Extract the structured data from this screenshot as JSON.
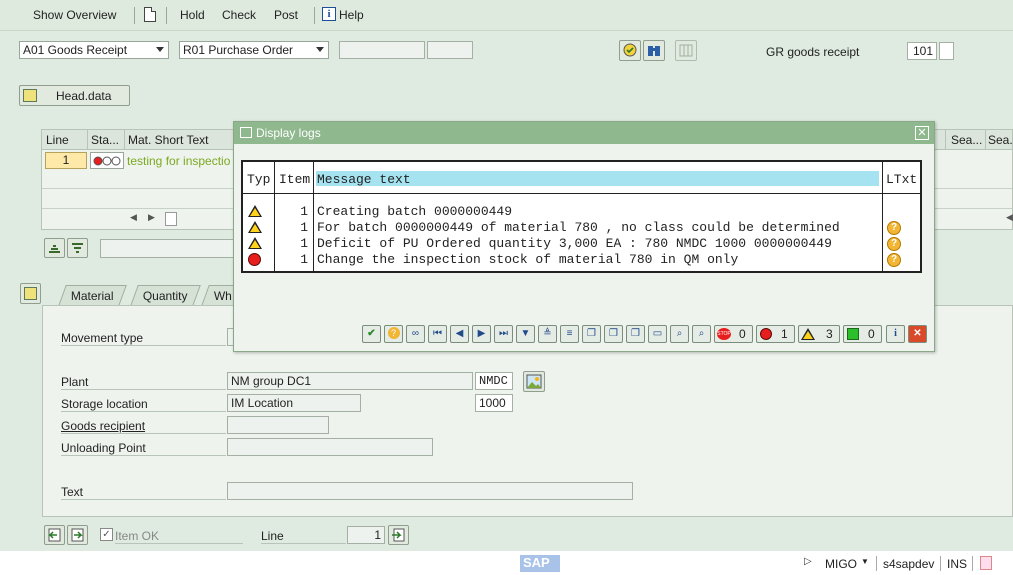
{
  "toolbar": {
    "show_overview": "Show Overview",
    "hold": "Hold",
    "check": "Check",
    "post": "Post",
    "help": "Help"
  },
  "header": {
    "action": "A01 Goods Receipt",
    "reference": "R01 Purchase Order",
    "gr_label": "GR goods receipt",
    "movement_code": "101",
    "head_data_button": "Head.data"
  },
  "grid": {
    "columns": [
      "Line",
      "Sta...",
      "Mat. Short Text",
      "Sea...",
      "Sea..."
    ],
    "rows": [
      {
        "line": "1",
        "text": "testing for inspectio"
      }
    ]
  },
  "tabs": [
    "Material",
    "Quantity",
    "Wh"
  ],
  "detail": {
    "movement_type_label": "Movement type",
    "plant_label": "Plant",
    "plant_value": "NM group DC1",
    "plant_code": "NMDC",
    "storage_label": "Storage location",
    "storage_value": "IM Location",
    "storage_code": "1000",
    "goods_recipient_label": "Goods recipient",
    "unloading_label": "Unloading Point",
    "text_label": "Text",
    "item_ok_label": "Item OK",
    "line_label": "Line",
    "line_value": "1"
  },
  "dialog": {
    "title": "Display logs",
    "columns": {
      "typ": "Typ",
      "item": "Item",
      "msg": "Message text",
      "ltxt": "LTxt"
    },
    "rows": [
      {
        "type": "warning",
        "item": "1",
        "text": "Creating batch 0000000449",
        "ltxt": false
      },
      {
        "type": "warning",
        "item": "1",
        "text": "For batch 0000000449 of material 780 , no class could be determined",
        "ltxt": true
      },
      {
        "type": "warning",
        "item": "1",
        "text": "Deficit of PU Ordered quantity 3,000 EA : 780 NMDC 1000 0000000449",
        "ltxt": true
      },
      {
        "type": "error",
        "item": "1",
        "text": "Change the inspection stock of material 780 in QM only",
        "ltxt": true
      }
    ],
    "counts": {
      "stop": "0",
      "error": "1",
      "warning": "3",
      "success": "0"
    }
  },
  "status_bar": {
    "tcode": "MIGO",
    "system": "s4sapdev",
    "mode": "INS",
    "logo": "SAP"
  },
  "colors": {
    "background": "#dfebe0",
    "dialog_title": "#8fb88f",
    "header_highlight": "#a6e3f1",
    "warning": "#ffd21c",
    "error": "#e81d1d"
  }
}
